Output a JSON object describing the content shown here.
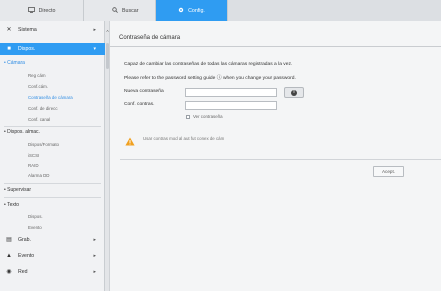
{
  "tabs": [
    {
      "label": "Directo",
      "icon": "monitor-icon"
    },
    {
      "label": "Buscar",
      "icon": "search-icon"
    },
    {
      "label": "Config.",
      "icon": "gear-icon",
      "active": true
    }
  ],
  "sidebar": {
    "sistema": "Sistema",
    "dispos": "Dispos.",
    "camara": {
      "label": "Cámara",
      "items": [
        "Reg cám",
        "Conf.cám.",
        "Contraseña de cámara",
        "Conf. de direcc",
        "Conf. canal"
      ]
    },
    "dispos_almac": {
      "label": "Dispos. almac.",
      "items": [
        "Dispos/Formato",
        "iSCSI",
        "RAID",
        "Alarma DD"
      ]
    },
    "supervisar": "Supervisar",
    "texto": {
      "label": "Texto",
      "items": [
        "Dispos.",
        "Evento"
      ]
    },
    "grab": "Grab.",
    "evento": "Evento",
    "red": "Red"
  },
  "main": {
    "title": "Contraseña de cámara",
    "desc1": "Capaz de cambiar las contraseñas de todas las cámaras registradas a la vez.",
    "desc2": "Please refer to the password setting guide ⓘ when you change your password.",
    "new_password_label": "Nueva contraseña",
    "confirm_label": "Conf. contras.",
    "show_password_label": "Ver contraseña",
    "warning_text": "Usar contras mod al aut fut conex de cám",
    "apply_label": "Acept."
  },
  "colors": {
    "accent": "#2f9cf2",
    "warning": "#f0a020"
  }
}
